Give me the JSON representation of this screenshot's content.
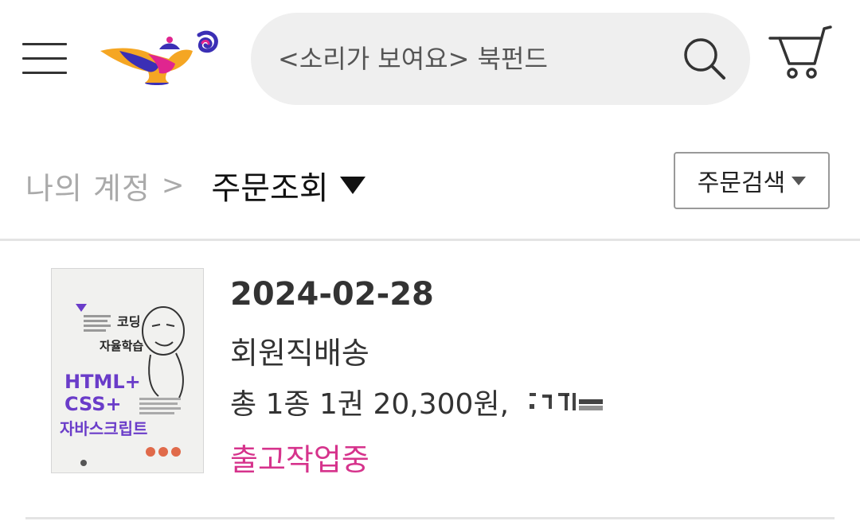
{
  "header": {
    "search": {
      "placeholder": "<소리가 보여요> 북펀드"
    }
  },
  "breadcrumb": {
    "parent": "나의 계정",
    "separator": ">",
    "current": "주문조회"
  },
  "order_search_label": "주문검색",
  "orders": [
    {
      "date": "2024-02-28",
      "delivery_type": "회원직배송",
      "summary": "총 1종 1권 20,300원,",
      "status": "출고작업중",
      "book": {
        "title_lines": [
          "코딩",
          "자율학습",
          "HTML+",
          "CSS+",
          "자바스크립트"
        ]
      }
    }
  ],
  "colors": {
    "status": "#d6338c",
    "search_bg": "#efefef",
    "logo_blue": "#3b2fb5",
    "logo_pink": "#e0258f",
    "logo_orange": "#f5a623"
  },
  "icons": {
    "menu": "hamburger-menu-icon",
    "logo": "genie-lamp-logo",
    "search": "search-icon",
    "cart": "cart-icon"
  }
}
